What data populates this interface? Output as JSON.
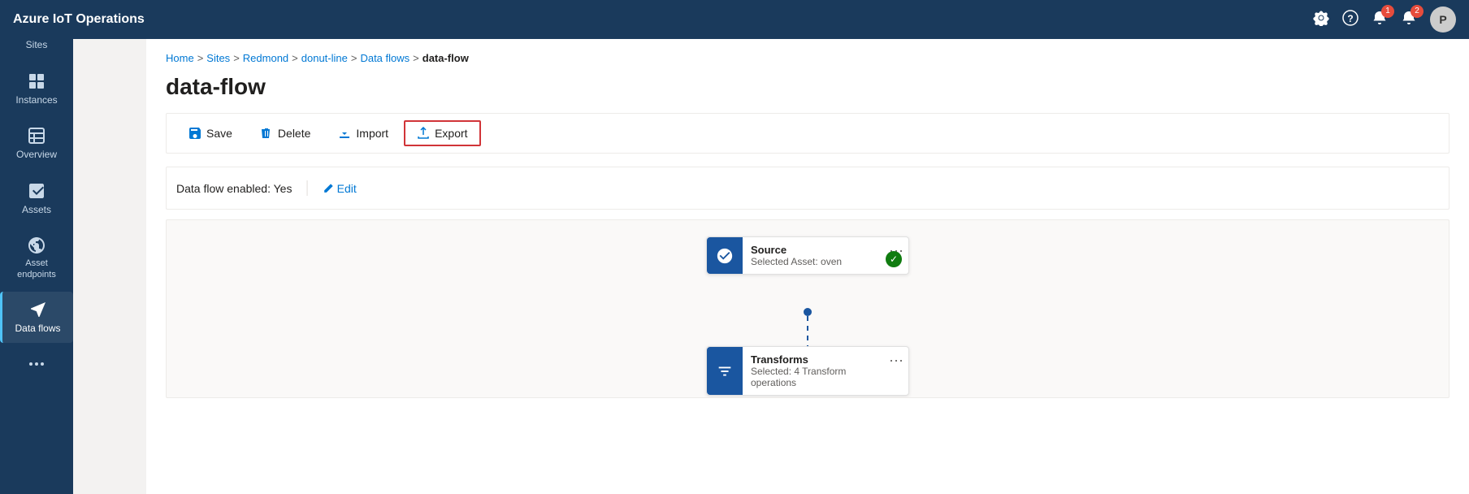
{
  "app": {
    "title": "Azure IoT Operations"
  },
  "topbar": {
    "title": "Azure IoT Operations",
    "icons": {
      "settings": "⚙",
      "help": "?",
      "bell1_badge": "1",
      "bell2_badge": "2",
      "avatar_label": "P"
    }
  },
  "sidebar": {
    "items": [
      {
        "id": "sites",
        "label": "Sites",
        "icon": "sites"
      },
      {
        "id": "instances",
        "label": "Instances",
        "icon": "instances"
      },
      {
        "id": "overview",
        "label": "Overview",
        "icon": "overview"
      },
      {
        "id": "assets",
        "label": "Assets",
        "icon": "assets"
      },
      {
        "id": "asset-endpoints",
        "label": "Asset endpoints",
        "icon": "asset-endpoints"
      },
      {
        "id": "data-flows",
        "label": "Data flows",
        "icon": "data-flows",
        "active": true
      },
      {
        "id": "more",
        "label": "",
        "icon": "more"
      }
    ]
  },
  "breadcrumb": {
    "items": [
      "Home",
      "Sites",
      "Redmond",
      "donut-line",
      "Data flows"
    ],
    "current": "data-flow"
  },
  "page": {
    "title": "data-flow"
  },
  "toolbar": {
    "save_label": "Save",
    "delete_label": "Delete",
    "import_label": "Import",
    "export_label": "Export"
  },
  "info": {
    "enabled_label": "Data flow enabled: Yes",
    "edit_label": "Edit"
  },
  "flow": {
    "source_node": {
      "title": "Source",
      "subtitle": "Selected Asset: oven"
    },
    "transforms_node": {
      "title": "Transforms",
      "subtitle": "Selected: 4 Transform operations"
    }
  }
}
